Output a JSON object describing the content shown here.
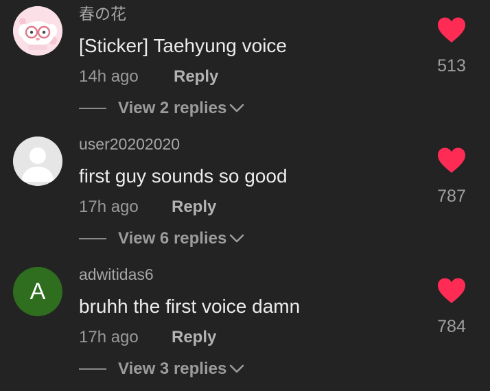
{
  "colors": {
    "background": "#232323",
    "like_heart": "#fe2c55",
    "avatar_letter_bg": "#2f6e1e"
  },
  "comments": [
    {
      "avatar": "sticker-avatar",
      "username": "春の花",
      "text": "[Sticker] Taehyung voice",
      "time": "14h ago",
      "reply_label": "Reply",
      "replies_label": "View 2 replies",
      "likes": "513"
    },
    {
      "avatar": "default-avatar",
      "username": "user20202020",
      "text": "first guy sounds so good",
      "time": "17h ago",
      "reply_label": "Reply",
      "replies_label": "View 6 replies",
      "likes": "787"
    },
    {
      "avatar": "letter-avatar",
      "avatar_letter": "A",
      "username": "adwitidas6",
      "text": "bruhh the first voice damn",
      "time": "17h ago",
      "reply_label": "Reply",
      "replies_label": "View 3 replies",
      "likes": "784"
    }
  ]
}
